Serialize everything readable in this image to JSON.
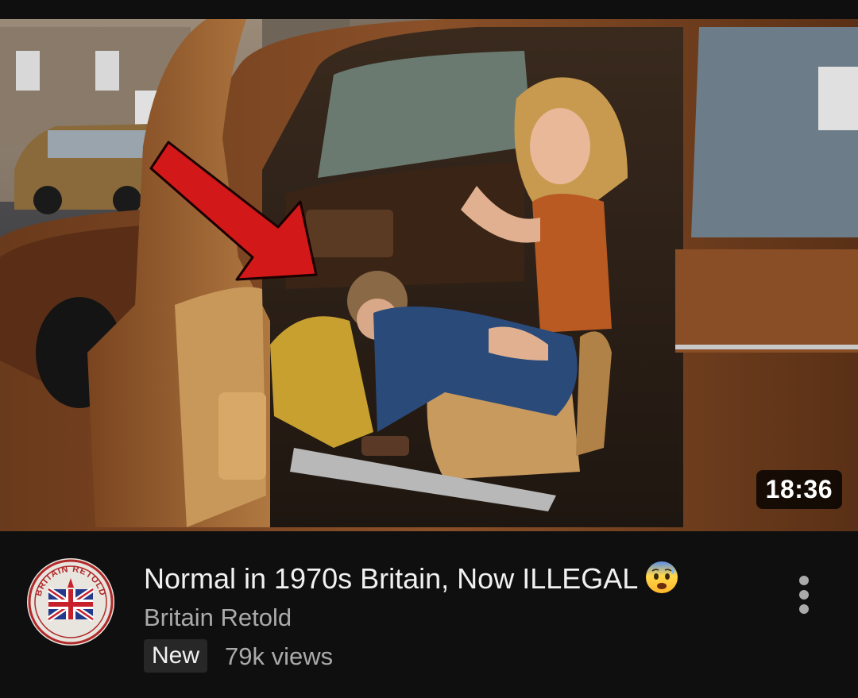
{
  "video": {
    "duration": "18:36",
    "title": "Normal in 1970s Britain, Now ILLEGAL",
    "title_emoji": "anxious-face-with-sweat",
    "channel": "Britain Retold",
    "badge": "New",
    "views": "79k views"
  },
  "icons": {
    "avatar": "britain-retold-logo",
    "more": "more-vertical-icon",
    "arrow": "red-arrow-pointer"
  },
  "logo": {
    "text": "BRITAIN RETOLD"
  },
  "colors": {
    "background": "#0f0f0f",
    "title": "#f1f1f1",
    "secondary": "#aaaaaa",
    "arrow": "#d21818"
  }
}
